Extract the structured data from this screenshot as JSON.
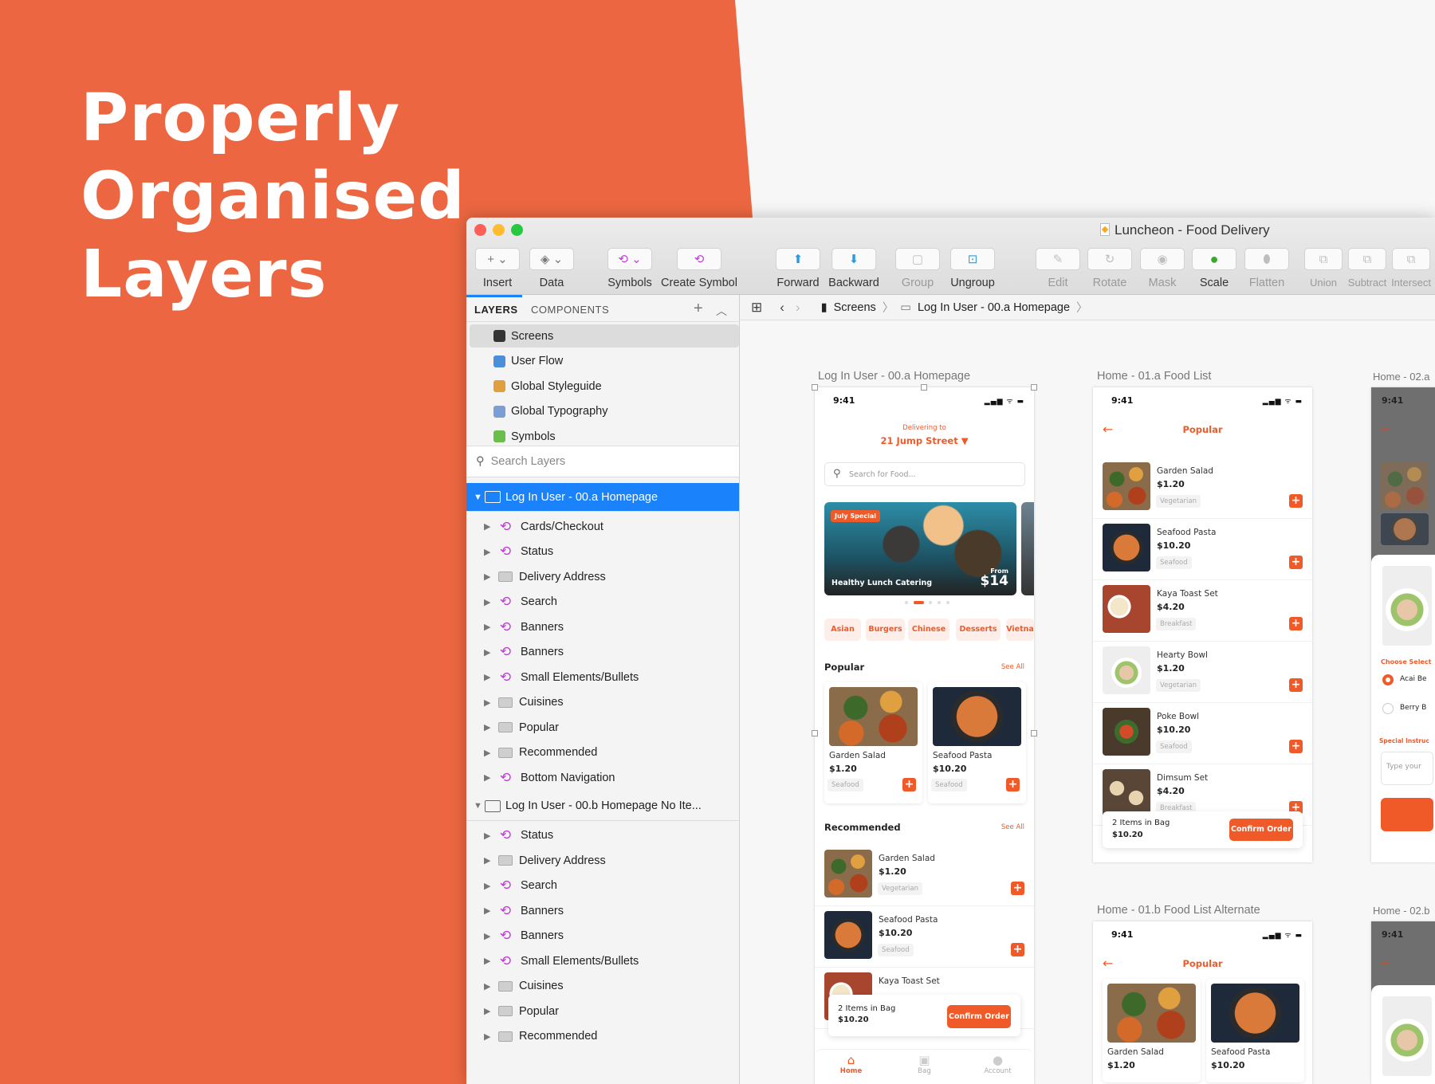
{
  "headline": [
    "Properly",
    "Organised",
    "Layers"
  ],
  "window": {
    "title": "Luncheon - Food Delivery"
  },
  "toolbar": [
    {
      "label": "Insert",
      "icon": "plus-icon",
      "glyph": "+ ⌄",
      "enabled": true
    },
    {
      "label": "Data",
      "icon": "layers-icon",
      "glyph": "◈ ⌄",
      "enabled": true
    },
    {
      "label": "Symbols",
      "icon": "symbol-icon",
      "glyph": "⟲ ⌄",
      "enabled": true
    },
    {
      "label": "Create Symbol",
      "icon": "create-symbol-icon",
      "glyph": "⟲",
      "enabled": true
    },
    {
      "label": "Forward",
      "icon": "forward-icon",
      "glyph": "⬆",
      "enabled": true
    },
    {
      "label": "Backward",
      "icon": "backward-icon",
      "glyph": "⬇",
      "enabled": true
    },
    {
      "label": "Group",
      "icon": "group-icon",
      "glyph": "▢",
      "enabled": false
    },
    {
      "label": "Ungroup",
      "icon": "ungroup-icon",
      "glyph": "⊡",
      "enabled": true
    },
    {
      "label": "Edit",
      "icon": "edit-icon",
      "glyph": "✎",
      "enabled": false
    },
    {
      "label": "Rotate",
      "icon": "rotate-icon",
      "glyph": "↻",
      "enabled": false
    },
    {
      "label": "Mask",
      "icon": "mask-icon",
      "glyph": "◉",
      "enabled": false
    },
    {
      "label": "Scale",
      "icon": "scale-icon",
      "glyph": "●",
      "enabled": true
    },
    {
      "label": "Flatten",
      "icon": "flatten-icon",
      "glyph": "⬮",
      "enabled": false
    },
    {
      "label": "Union",
      "icon": "union-icon",
      "glyph": "⧉",
      "enabled": false
    },
    {
      "label": "Subtract",
      "icon": "subtract-icon",
      "glyph": "⧉",
      "enabled": false
    },
    {
      "label": "Intersect",
      "icon": "intersect-icon",
      "glyph": "⧉",
      "enabled": false
    }
  ],
  "sidebar": {
    "tabs": [
      "LAYERS",
      "COMPONENTS"
    ],
    "pages": [
      {
        "label": "Screens",
        "color": "#333333",
        "selected": true
      },
      {
        "label": "User Flow",
        "color": "#4a90d9"
      },
      {
        "label": "Global Styleguide",
        "color": "#e0a040"
      },
      {
        "label": "Global Typography",
        "color": "#7b9fd4"
      },
      {
        "label": "Symbols",
        "color": "#6abf4b"
      }
    ],
    "search_placeholder": "Search Layers",
    "groups": [
      {
        "label": "Log In User - 00.a Homepage",
        "selected": true,
        "children": [
          {
            "label": "Cards/Checkout",
            "type": "symbol"
          },
          {
            "label": "Status",
            "type": "symbol"
          },
          {
            "label": "Delivery Address",
            "type": "folder"
          },
          {
            "label": "Search",
            "type": "symbol"
          },
          {
            "label": "Banners",
            "type": "symbol"
          },
          {
            "label": "Banners",
            "type": "symbol"
          },
          {
            "label": "Small Elements/Bullets",
            "type": "symbol"
          },
          {
            "label": "Cuisines",
            "type": "folder"
          },
          {
            "label": "Popular",
            "type": "folder"
          },
          {
            "label": "Recommended",
            "type": "folder"
          },
          {
            "label": "Bottom Navigation",
            "type": "symbol"
          }
        ]
      },
      {
        "label": "Log In User - 00.b Homepage No Ite...",
        "selected": false,
        "children": [
          {
            "label": "Status",
            "type": "symbol"
          },
          {
            "label": "Delivery Address",
            "type": "folder"
          },
          {
            "label": "Search",
            "type": "symbol"
          },
          {
            "label": "Banners",
            "type": "symbol"
          },
          {
            "label": "Banners",
            "type": "symbol"
          },
          {
            "label": "Small Elements/Bullets",
            "type": "symbol"
          },
          {
            "label": "Cuisines",
            "type": "folder"
          },
          {
            "label": "Popular",
            "type": "folder"
          },
          {
            "label": "Recommended",
            "type": "folder"
          }
        ]
      }
    ]
  },
  "breadcrumb": {
    "page": "Screens",
    "artboard": "Log In User - 00.a Homepage"
  },
  "artboards": {
    "home": {
      "label": "Log In User - 00.a Homepage",
      "time": "9:41",
      "delivering": "Delivering to",
      "address": "21 Jump Street ▼",
      "search_placeholder": "Search for Food...",
      "banner": {
        "badge": "July Special",
        "title": "Healthy Lunch Catering",
        "from": "From",
        "price": "$14"
      },
      "cuisines": [
        "Asian",
        "Burgers",
        "Chinese",
        "Desserts",
        "Vietna"
      ],
      "popular_title": "Popular",
      "see_all": "See All",
      "popular": [
        {
          "name": "Garden Salad",
          "price": "$1.20",
          "tag": "Seafood",
          "img": "salad"
        },
        {
          "name": "Seafood Pasta",
          "price": "$10.20",
          "tag": "Seafood",
          "img": "pasta"
        }
      ],
      "recommended_title": "Recommended",
      "recommended": [
        {
          "name": "Garden Salad",
          "price": "$1.20",
          "tag": "Vegetarian",
          "img": "salad"
        },
        {
          "name": "Seafood Pasta",
          "price": "$10.20",
          "tag": "Seafood",
          "img": "pasta"
        },
        {
          "name": "Kaya Toast Set",
          "price": "",
          "tag": "",
          "img": "toast"
        }
      ],
      "bag": {
        "items": "2 Items in Bag",
        "total": "$10.20",
        "button": "Confirm Order"
      },
      "nav": [
        {
          "label": "Home",
          "active": true
        },
        {
          "label": "Bag"
        },
        {
          "label": "Account"
        }
      ]
    },
    "list": {
      "label": "Home - 01.a Food List",
      "time": "9:41",
      "title": "Popular",
      "items": [
        {
          "name": "Garden Salad",
          "price": "$1.20",
          "tag": "Vegetarian",
          "img": "salad"
        },
        {
          "name": "Seafood Pasta",
          "price": "$10.20",
          "tag": "Seafood",
          "img": "pasta"
        },
        {
          "name": "Kaya Toast Set",
          "price": "$4.20",
          "tag": "Breakfast",
          "img": "toast"
        },
        {
          "name": "Hearty Bowl",
          "price": "$1.20",
          "tag": "Vegetarian",
          "img": "bowl"
        },
        {
          "name": "Poke Bowl",
          "price": "$10.20",
          "tag": "Seafood",
          "img": "poke"
        },
        {
          "name": "Dimsum Set",
          "price": "$4.20",
          "tag": "Breakfast",
          "img": "dim"
        }
      ],
      "bag": {
        "items": "2 Items in Bag",
        "total": "$10.20",
        "button": "Confirm Order"
      }
    },
    "list_alt": {
      "label": "Home - 01.b Food List Alternate",
      "time": "9:41",
      "title": "Popular",
      "items": [
        {
          "name": "Garden Salad",
          "price": "$1.20",
          "img": "salad"
        },
        {
          "name": "Seafood Pasta",
          "price": "$10.20",
          "img": "pasta"
        }
      ]
    },
    "detail": {
      "label": "Home - 02.a",
      "time": "9:41",
      "choose": "Choose Select",
      "options": [
        "Acai Be",
        "Berry B"
      ],
      "special": "Special Instruc",
      "input_placeholder": "Type your"
    },
    "detail_b": {
      "label": "Home - 02.b",
      "time": "9:41"
    }
  },
  "colors": {
    "brand": "#ec6741",
    "accent": "#f05a28",
    "selection": "#1a82fb"
  }
}
